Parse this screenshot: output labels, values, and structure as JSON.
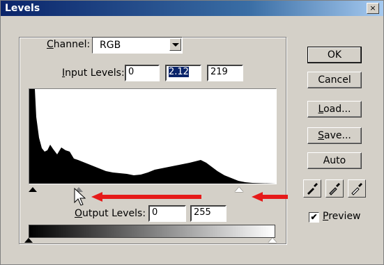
{
  "window": {
    "title": "Levels",
    "close_glyph": "×"
  },
  "channel": {
    "label_underlined": "C",
    "label_rest": "hannel:",
    "value": "RGB"
  },
  "input_levels": {
    "label_underlined": "I",
    "label_rest": "nput Levels:",
    "black": "0",
    "gamma": "2.12",
    "white": "219"
  },
  "output_levels": {
    "label_underlined": "O",
    "label_rest": "utput Levels:",
    "black": "0",
    "white": "255"
  },
  "buttons": {
    "ok": "OK",
    "cancel": "Cancel",
    "load_underlined": "L",
    "load_rest": "oad...",
    "save_underlined": "S",
    "save_rest": "ave...",
    "auto": "Auto"
  },
  "preview": {
    "label_underlined": "P",
    "label_rest": "review",
    "checked_glyph": "✔"
  },
  "icons": [
    "close-icon",
    "dropdown-arrow-icon",
    "black-eyedropper-icon",
    "gray-eyedropper-icon",
    "white-eyedropper-icon",
    "cursor-icon",
    "arrow-icon"
  ],
  "colors": {
    "title_bar_start": "#0a246a",
    "title_bar_end": "#a6caf0",
    "annotation_arrow": "#e61a1a",
    "dialog_bg": "#d4d0c8"
  }
}
